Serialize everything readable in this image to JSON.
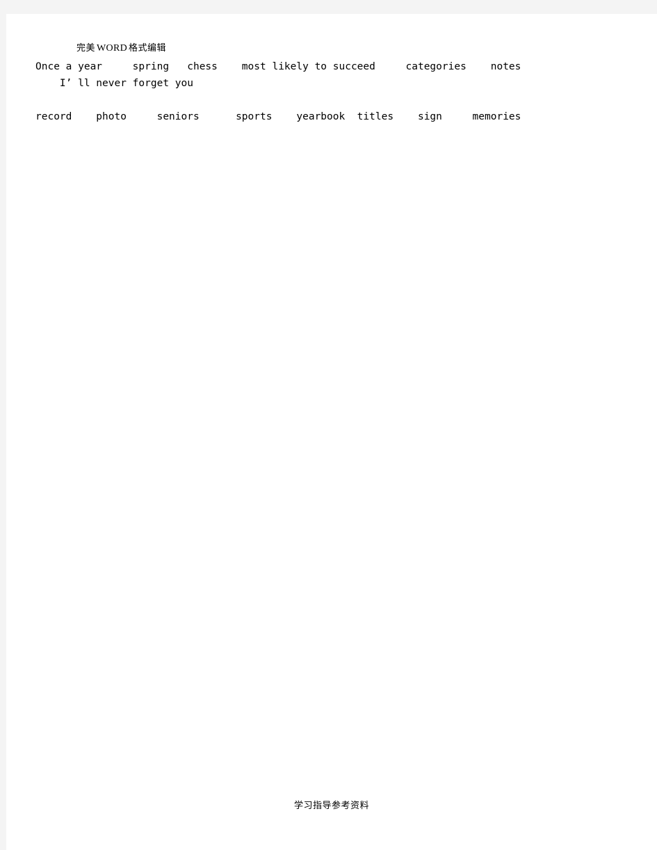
{
  "page": {
    "background_color": "#f4f4f4",
    "paper_color": "#ffffff"
  },
  "header": {
    "chinese_prefix": "完美",
    "word_mark": "WORD",
    "chinese_suffix": "格式编辑",
    "full_text": "完美WORD格式编辑"
  },
  "body": {
    "lines": [
      {
        "id": "line-1",
        "text": "Once a year     spring   chess    most likely to succeed     categories    notes"
      },
      {
        "id": "line-2",
        "text": "    I’ ll never forget you"
      },
      {
        "id": "line-3",
        "text": "record    photo     seniors      sports    yearbook  titles    sign     memories"
      }
    ],
    "words": [
      "Once a year",
      "spring",
      "chess",
      "most likely to succeed",
      "categories",
      "notes",
      "I’ ll never forget you",
      "record",
      "photo",
      "seniors",
      "sports",
      "yearbook",
      "titles",
      "sign",
      "memories"
    ]
  },
  "footer": {
    "text": "学习指导参考资料"
  }
}
